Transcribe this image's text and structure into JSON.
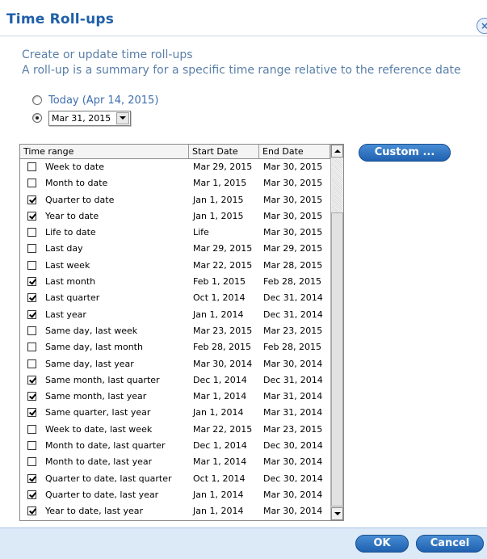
{
  "dialog": {
    "title": "Time Roll-ups",
    "close_label": "×",
    "desc_line1": "Create or update time roll-ups",
    "desc_line2": "A roll-up is a summary for a specific time range relative to the reference date",
    "radio_today_label": "Today (Apr 14, 2015)",
    "radio_date_selected": true,
    "date_select_value": "Mar 31, 2015",
    "custom_button": "Custom ...",
    "ok_button": "OK",
    "cancel_button": "Cancel"
  },
  "table": {
    "headers": [
      "Time range",
      "Start Date",
      "End Date"
    ],
    "rows": [
      {
        "checked": false,
        "name": "Week to date",
        "start": "Mar 29, 2015",
        "end": "Mar 30, 2015"
      },
      {
        "checked": false,
        "name": "Month to date",
        "start": "Mar 1, 2015",
        "end": "Mar 30, 2015"
      },
      {
        "checked": true,
        "name": "Quarter to date",
        "start": "Jan 1, 2015",
        "end": "Mar 30, 2015"
      },
      {
        "checked": true,
        "name": "Year to date",
        "start": "Jan 1, 2015",
        "end": "Mar 30, 2015"
      },
      {
        "checked": false,
        "name": "Life to date",
        "start": "Life",
        "end": "Mar 30, 2015"
      },
      {
        "checked": false,
        "name": "Last day",
        "start": "Mar 29, 2015",
        "end": "Mar 29, 2015"
      },
      {
        "checked": false,
        "name": "Last week",
        "start": "Mar 22, 2015",
        "end": "Mar 28, 2015"
      },
      {
        "checked": true,
        "name": "Last month",
        "start": "Feb 1, 2015",
        "end": "Feb 28, 2015"
      },
      {
        "checked": true,
        "name": "Last quarter",
        "start": "Oct 1, 2014",
        "end": "Dec 31, 2014"
      },
      {
        "checked": true,
        "name": "Last year",
        "start": "Jan 1, 2014",
        "end": "Dec 31, 2014"
      },
      {
        "checked": false,
        "name": "Same day, last week",
        "start": "Mar 23, 2015",
        "end": "Mar 23, 2015"
      },
      {
        "checked": false,
        "name": "Same day, last month",
        "start": "Feb 28, 2015",
        "end": "Feb 28, 2015"
      },
      {
        "checked": false,
        "name": "Same day, last year",
        "start": "Mar 30, 2014",
        "end": "Mar 30, 2014"
      },
      {
        "checked": true,
        "name": "Same month, last quarter",
        "start": "Dec 1, 2014",
        "end": "Dec 31, 2014"
      },
      {
        "checked": true,
        "name": "Same month, last year",
        "start": "Mar 1, 2014",
        "end": "Mar 31, 2014"
      },
      {
        "checked": true,
        "name": "Same quarter, last year",
        "start": "Jan 1, 2014",
        "end": "Mar 31, 2014"
      },
      {
        "checked": false,
        "name": "Week to date, last week",
        "start": "Mar 22, 2015",
        "end": "Mar 23, 2015"
      },
      {
        "checked": false,
        "name": "Month to date, last quarter",
        "start": "Dec 1, 2014",
        "end": "Dec 30, 2014"
      },
      {
        "checked": false,
        "name": "Month to date, last year",
        "start": "Mar 1, 2014",
        "end": "Mar 30, 2014"
      },
      {
        "checked": true,
        "name": "Quarter to date, last quarter",
        "start": "Oct 1, 2014",
        "end": "Dec 30, 2014"
      },
      {
        "checked": true,
        "name": "Quarter to date, last year",
        "start": "Jan 1, 2014",
        "end": "Mar 30, 2014"
      },
      {
        "checked": true,
        "name": "Year to date, last year",
        "start": "Jan 1, 2014",
        "end": "Mar 30, 2014"
      }
    ]
  },
  "colors": {
    "title": "#1f5fa8",
    "description": "#5a7fa8",
    "button": "#2a6fc0",
    "footer": "#dce9f7"
  }
}
